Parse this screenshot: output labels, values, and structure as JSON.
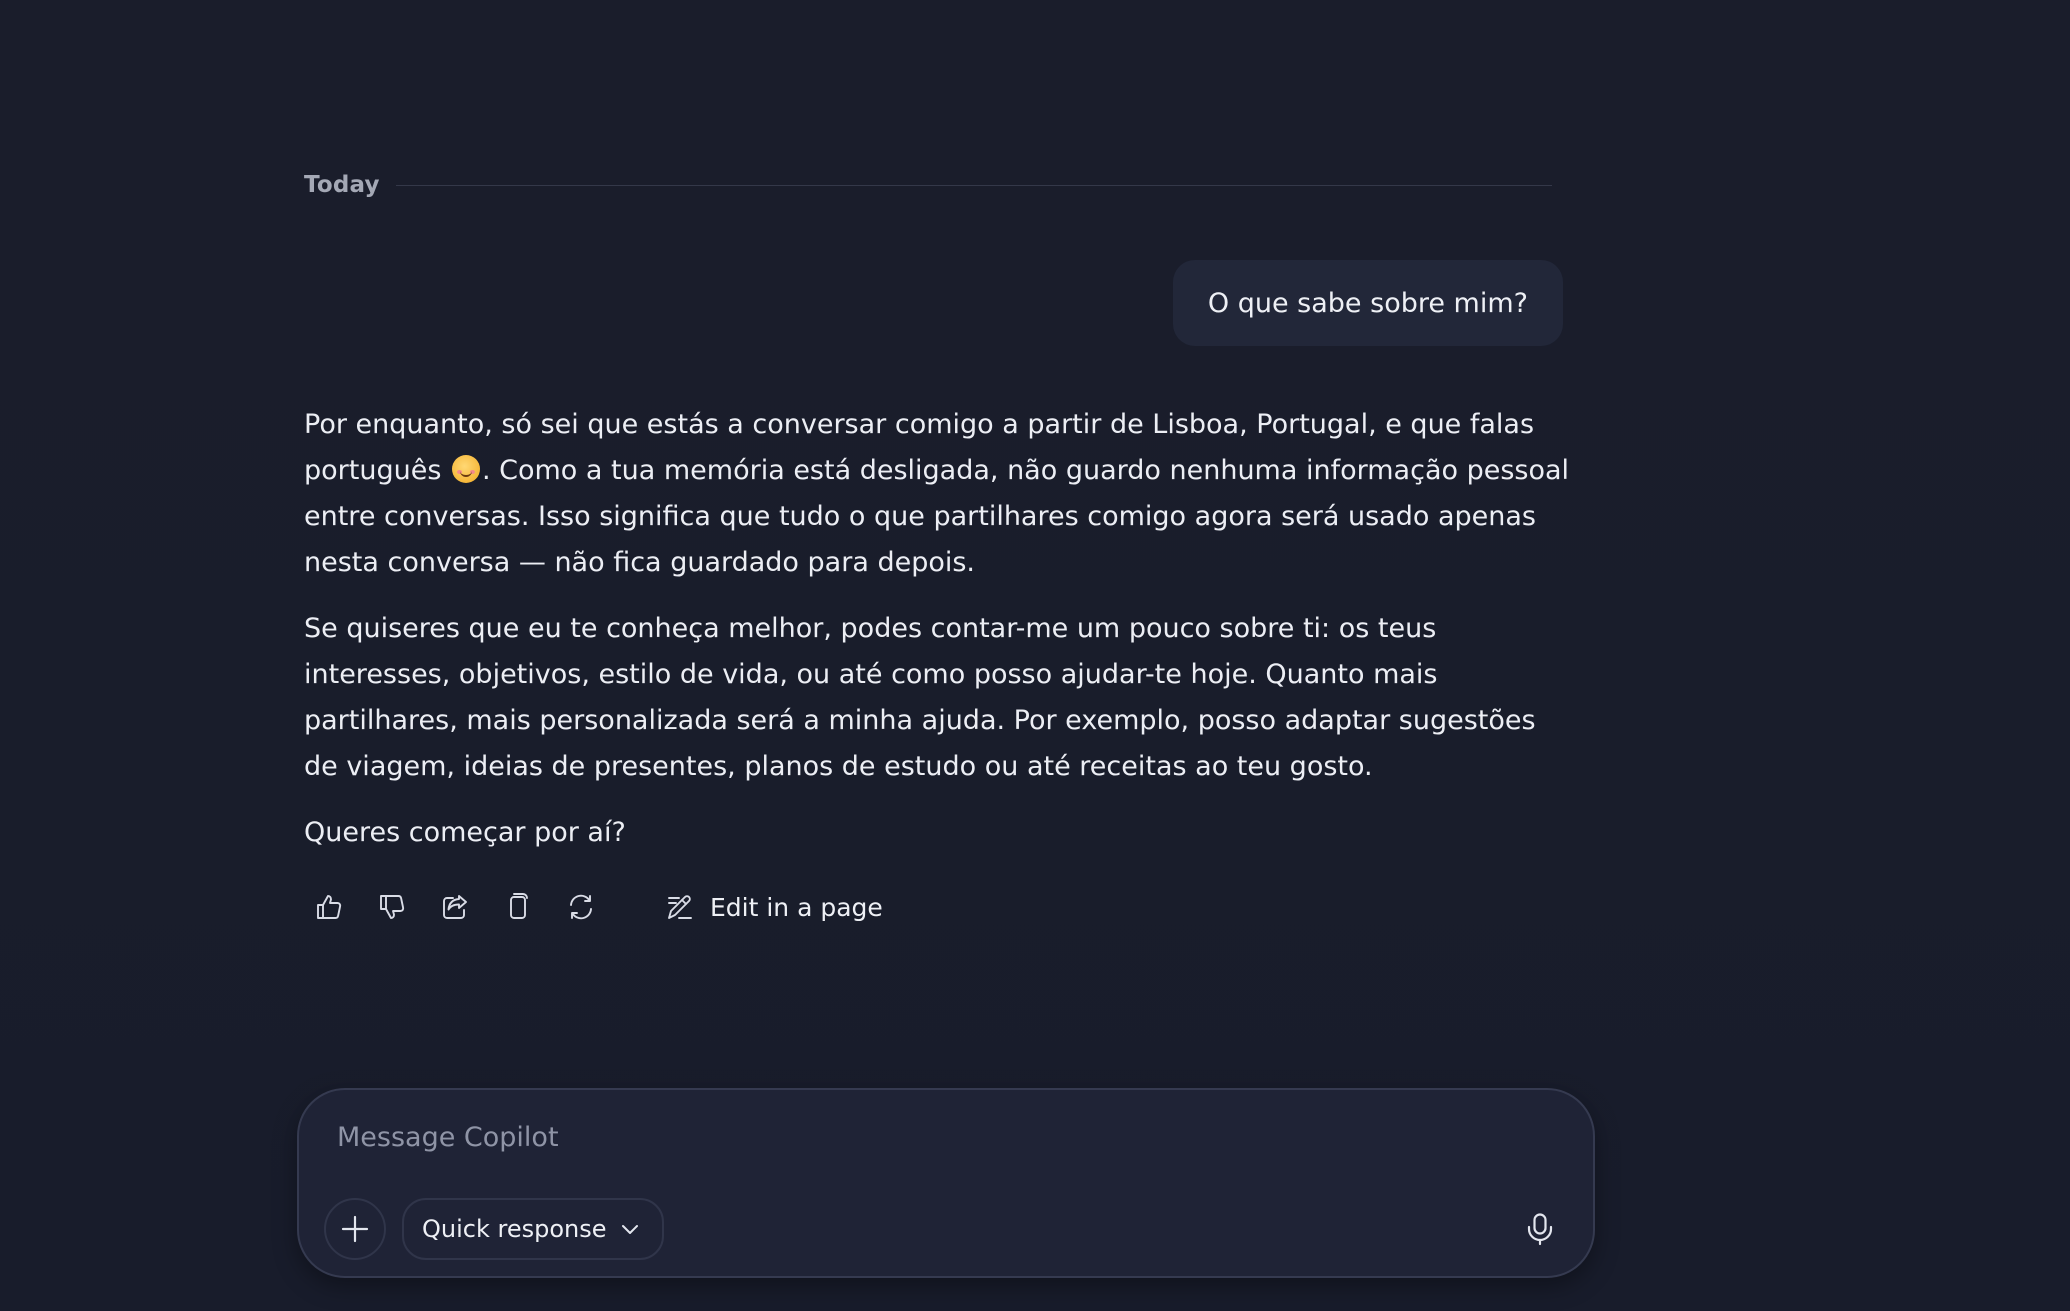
{
  "conversation": {
    "day_label": "Today",
    "user_message": "O que sabe sobre mim?",
    "assistant": {
      "p1_before_emoji": "Por enquanto, só sei que estás a conversar comigo a partir de Lisboa, Portugal, e que falas português ",
      "emoji": "smiling-face-icon",
      "p1_after_emoji": ". Como a tua memória está desligada, não guardo nenhuma informação pessoal entre conversas. Isso significa que tudo o que partilhares comigo agora será usado apenas nesta conversa — não fica guardado para depois.",
      "p2": "Se quiseres que eu te conheça melhor, podes contar-me um pouco sobre ti: os teus interesses, objetivos, estilo de vida, ou até como posso ajudar-te hoje. Quanto mais partilhares, mais personalizada será a minha ajuda. Por exemplo, posso adaptar sugestões de viagem, ideias de presentes, planos de estudo ou até receitas ao teu gosto.",
      "p3": "Queres começar por aí?"
    },
    "actions": {
      "icons": [
        "thumbs-up-icon",
        "thumbs-down-icon",
        "share-icon",
        "copy-icon",
        "regenerate-icon"
      ],
      "edit_label": "Edit in a page",
      "edit_icon": "edit-page-icon"
    }
  },
  "composer": {
    "placeholder": "Message Copilot",
    "value": "",
    "plus_icon": "plus-icon",
    "mode_label": "Quick response",
    "mode_icon": "chevron-down-icon",
    "mic_icon": "microphone-icon"
  },
  "colors": {
    "background": "#191d2c",
    "user_bubble": "#222739",
    "composer_bg": "#1f2336",
    "text": "#eceef4",
    "muted_text": "#a4a8b5"
  }
}
